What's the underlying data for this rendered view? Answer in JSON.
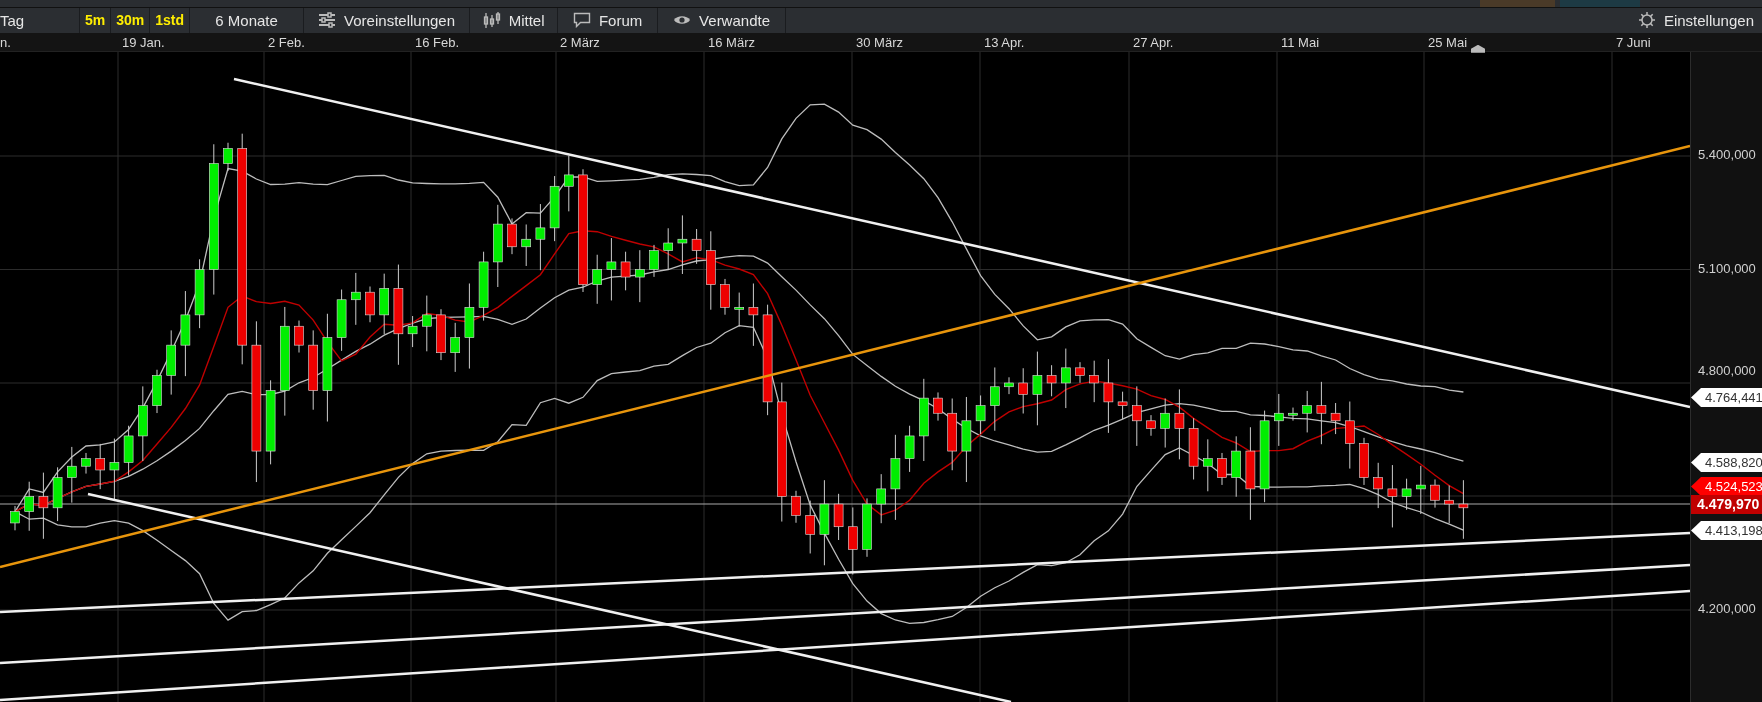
{
  "toolbar": {
    "range_label": "Tag",
    "intervals": [
      "5m",
      "30m",
      "1std"
    ],
    "period": "6 Monate",
    "buttons": [
      {
        "label": "Voreinstellungen",
        "kind": "sliders"
      },
      {
        "label": "Mittel",
        "kind": "candles"
      },
      {
        "label": "Forum",
        "kind": "speech"
      },
      {
        "label": "Verwandte",
        "kind": "eye"
      }
    ],
    "settings": "Einstellungen"
  },
  "date_axis": [
    "n.",
    "19 Jan.",
    "2 Feb.",
    "16 Feb.",
    "2 März",
    "16 März",
    "30 März",
    "13 Apr.",
    "27 Apr.",
    "11 Mai",
    "25 Mai",
    "7 Juni"
  ],
  "price_axis": [
    "5.400,000",
    "5.100,000",
    "4.800,000",
    "4.200,000"
  ],
  "price_flags": [
    {
      "label": "4.764,441",
      "kind": "line"
    },
    {
      "label": "4.588,820",
      "kind": "line"
    },
    {
      "label": "4.524,523",
      "kind": "indicator"
    },
    {
      "label": "4.479,970",
      "kind": "last"
    },
    {
      "label": "4.413,198",
      "kind": "line"
    }
  ]
}
